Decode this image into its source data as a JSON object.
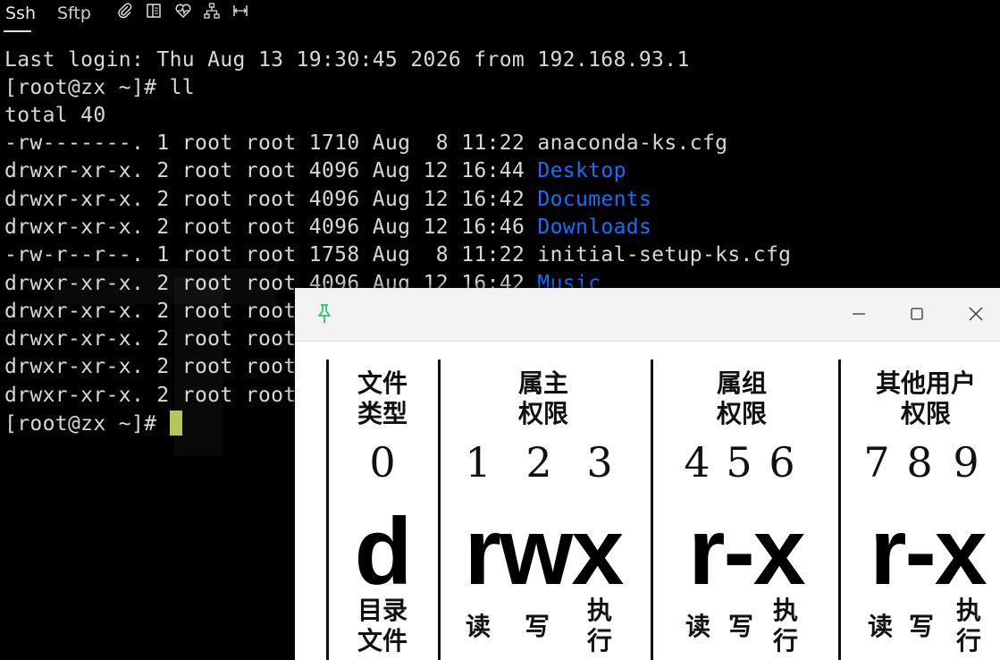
{
  "tabs": [
    {
      "label": "Ssh"
    },
    {
      "label": "Sftp"
    }
  ],
  "toolbar_icons": [
    "paperclip-icon",
    "split-panel-icon",
    "heartbeat-icon",
    "network-icon",
    "width-icon"
  ],
  "terminal": {
    "lines": [
      "Last login: Thu Aug 13 19:30:45 2026 from 192.168.93.1",
      "[root@zx ~]# ll",
      "total 40"
    ],
    "listing": [
      {
        "perms": "-rw-------.",
        "links": "1",
        "owner": "root",
        "group": "root",
        "size": "1710",
        "month": "Aug",
        "day": " 8",
        "time": "11:22",
        "name": "anaconda-ks.cfg",
        "is_dir": false
      },
      {
        "perms": "drwxr-xr-x.",
        "links": "2",
        "owner": "root",
        "group": "root",
        "size": "4096",
        "month": "Aug",
        "day": "12",
        "time": "16:44",
        "name": "Desktop",
        "is_dir": true
      },
      {
        "perms": "drwxr-xr-x.",
        "links": "2",
        "owner": "root",
        "group": "root",
        "size": "4096",
        "month": "Aug",
        "day": "12",
        "time": "16:42",
        "name": "Documents",
        "is_dir": true
      },
      {
        "perms": "drwxr-xr-x.",
        "links": "2",
        "owner": "root",
        "group": "root",
        "size": "4096",
        "month": "Aug",
        "day": "12",
        "time": "16:46",
        "name": "Downloads",
        "is_dir": true
      },
      {
        "perms": "-rw-r--r--.",
        "links": "1",
        "owner": "root",
        "group": "root",
        "size": "1758",
        "month": "Aug",
        "day": " 8",
        "time": "11:22",
        "name": "initial-setup-ks.cfg",
        "is_dir": false
      },
      {
        "perms": "drwxr-xr-x.",
        "links": "2",
        "owner": "root",
        "group": "root",
        "size": "4096",
        "month": "Aug",
        "day": "12",
        "time": "16:42",
        "name": "Music",
        "is_dir": true
      },
      {
        "perms": "drwxr-xr-x.",
        "links": "2",
        "owner": "root",
        "group": "root",
        "size": "",
        "month": "",
        "day": "",
        "time": "",
        "name": "",
        "is_dir": true
      },
      {
        "perms": "drwxr-xr-x.",
        "links": "2",
        "owner": "root",
        "group": "root",
        "size": "",
        "month": "",
        "day": "",
        "time": "",
        "name": "",
        "is_dir": true
      },
      {
        "perms": "drwxr-xr-x.",
        "links": "2",
        "owner": "root",
        "group": "root",
        "size": "",
        "month": "",
        "day": "",
        "time": "",
        "name": "",
        "is_dir": true
      },
      {
        "perms": "drwxr-xr-x.",
        "links": "2",
        "owner": "root",
        "group": "root",
        "size": "",
        "month": "",
        "day": "",
        "time": "",
        "name": "",
        "is_dir": true
      }
    ],
    "prompt": "[root@zx ~]# ",
    "colors": {
      "text": "#d8d8d8",
      "directory": "#1e6cff",
      "cursor": "#b9c55a",
      "background": "#000000"
    }
  },
  "popup": {
    "title_icons": [
      "pin-icon",
      "minimize-icon",
      "maximize-icon",
      "close-icon"
    ],
    "pin_color": "#2fbf71",
    "sections": [
      {
        "heading": [
          "文件",
          "类型"
        ],
        "digits": [
          "0"
        ],
        "symbol": "d",
        "footer": [
          "目录",
          "文件"
        ]
      },
      {
        "heading": [
          "属主",
          "权限"
        ],
        "digits": [
          "1",
          "2",
          "3"
        ],
        "symbol": "rwx",
        "footer": [
          "读",
          "写",
          "执",
          "行"
        ]
      },
      {
        "heading": [
          "属组",
          "权限"
        ],
        "digits": [
          "4",
          "5",
          "6"
        ],
        "symbol": "r-x",
        "footer": [
          "读",
          "写",
          "执",
          "行"
        ]
      },
      {
        "heading": [
          "其他用户",
          "权限"
        ],
        "digits": [
          "7",
          "8",
          "9"
        ],
        "symbol": "r-x",
        "footer": [
          "读",
          "写",
          "执",
          "行"
        ]
      }
    ]
  }
}
